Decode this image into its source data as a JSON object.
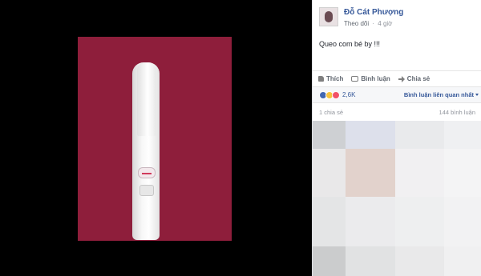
{
  "post": {
    "author_name": "Đỗ Cát Phượng",
    "follow_label": "Theo dõi",
    "dot": "·",
    "time_ago": "4 giờ",
    "caption": "Queo com bé by !!!"
  },
  "actions": {
    "like_label": "Thích",
    "comment_label": "Bình luận",
    "share_label": "Chia sẻ"
  },
  "reactions": {
    "count": "2,6K",
    "sort_label": "Bình luận liên quan nhất",
    "emoji": [
      "like",
      "haha",
      "love"
    ]
  },
  "stats": {
    "shares": "1 chia sẻ",
    "comments": "144 bình luận"
  },
  "colors": {
    "link_blue": "#365899",
    "photo_background": "#8e1e3b",
    "viewer_background": "#000000"
  },
  "blurred_cells": [
    "#ced0d3",
    "#dde0eb",
    "#e9eaec",
    "#eff0f2",
    "#e9e8e9",
    "#e2d2cc",
    "#f1f0f2",
    "#f4f4f5",
    "#e4e5e6",
    "#ebebed",
    "#eeeff0",
    "#f2f2f3",
    "#cbcccd",
    "#e1e2e3",
    "#e9e9ea",
    "#f0f0f1"
  ]
}
